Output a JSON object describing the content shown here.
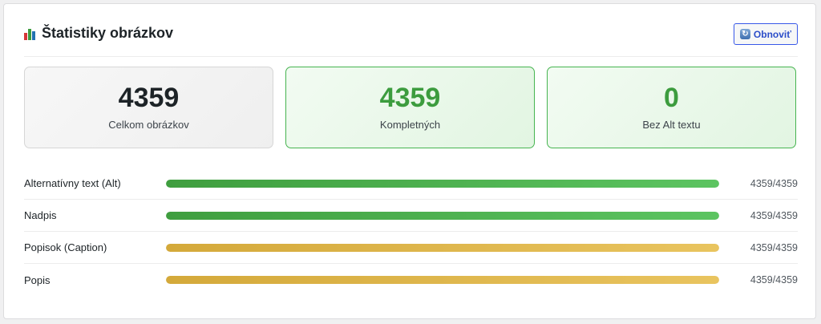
{
  "header": {
    "icon": "bar-chart-icon",
    "title": "Štatistiky obrázkov",
    "refresh_label": "Obnoviť",
    "refresh_icon": "refresh-icon"
  },
  "cards": [
    {
      "value": "4359",
      "label": "Celkom obrázkov"
    },
    {
      "value": "4359",
      "label": "Kompletných"
    },
    {
      "value": "0",
      "label": "Bez Alt textu"
    }
  ],
  "rows": [
    {
      "label": "Alternatívny text (Alt)",
      "count": "4359/4359",
      "fraction": 1.0,
      "color": "#4caf50"
    },
    {
      "label": "Nadpis",
      "count": "4359/4359",
      "fraction": 1.0,
      "color": "#4caf50"
    },
    {
      "label": "Popisok (Caption)",
      "count": "4359/4359",
      "fraction": 1.0,
      "color": "#ddb34a"
    },
    {
      "label": "Popis",
      "count": "4359/4359",
      "fraction": 1.0,
      "color": "#ddb34a"
    }
  ]
}
